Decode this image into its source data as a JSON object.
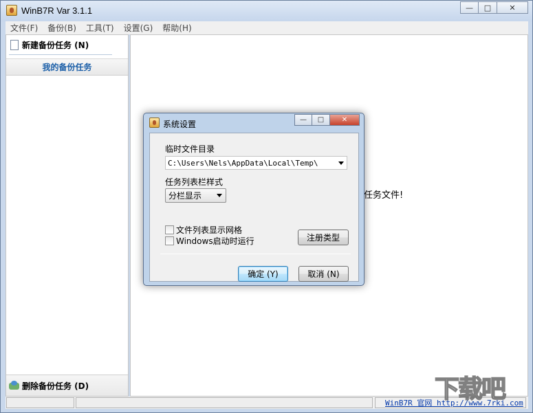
{
  "window": {
    "title": "WinB7R Var 3.1.1",
    "caption": {
      "minimize": "—",
      "maximize": "□",
      "close": "✕"
    }
  },
  "menu": [
    {
      "label": "文件(F)"
    },
    {
      "label": "备份(B)"
    },
    {
      "label": "工具(T)"
    },
    {
      "label": "设置(G)"
    },
    {
      "label": "帮助(H)"
    }
  ],
  "sidebar": {
    "new_task": "新建备份任务 (N)",
    "my_tasks": "我的备份任务",
    "delete_task": "删除备份任务 (D)"
  },
  "main": {
    "hint": "任务文件!"
  },
  "statusbar": {
    "link_text": "WinB7R 官网 http://www.7rki.com"
  },
  "watermark": "下载吧",
  "dialog": {
    "title": "系统设置",
    "caption": {
      "minimize": "—",
      "maximize": "□",
      "close": "✕"
    },
    "temp_dir_label": "临时文件目录",
    "temp_dir_value": "C:\\Users\\Nels\\AppData\\Local\\Temp\\",
    "taskbar_style_label": "任务列表栏样式",
    "taskbar_style_value": "分栏显示",
    "show_grid_label": "文件列表显示网格",
    "autostart_label": "Windows启动时运行",
    "register_button": "注册类型",
    "ok_button": "确定 (Y)",
    "cancel_button": "取消 (N)"
  }
}
